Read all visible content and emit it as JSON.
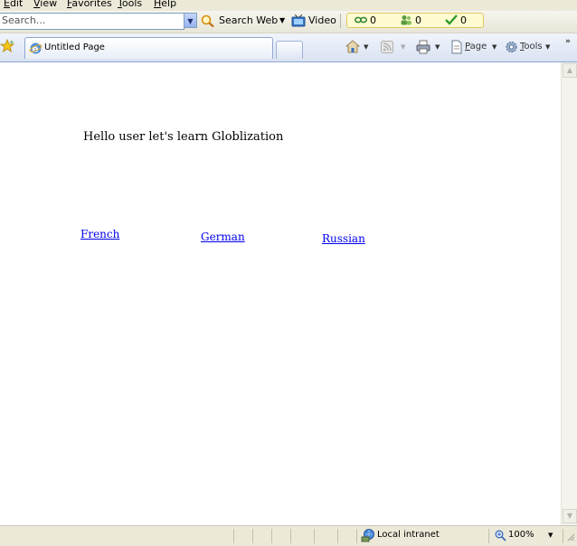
{
  "menu": {
    "items": [
      "Edit",
      "View",
      "Favorites",
      "Tools",
      "Help"
    ]
  },
  "toolbar": {
    "search_placeholder": "Search...",
    "search_web_label": "Search Web",
    "video_label": "Video",
    "counters": [
      "0",
      "0",
      "0"
    ]
  },
  "tab": {
    "title": "Untitled Page"
  },
  "commands": {
    "page_label": "Page",
    "tools_label": "Tools"
  },
  "content": {
    "greeting": "Hello user let's learn Globlization",
    "links": [
      "French",
      "German",
      "Russian"
    ]
  },
  "status": {
    "zone": "Local intranet",
    "zoom": "100%"
  },
  "colors": {
    "link": "#0000ee",
    "chrome": "#ece9d8",
    "tab_bar": "#dae3f3"
  }
}
